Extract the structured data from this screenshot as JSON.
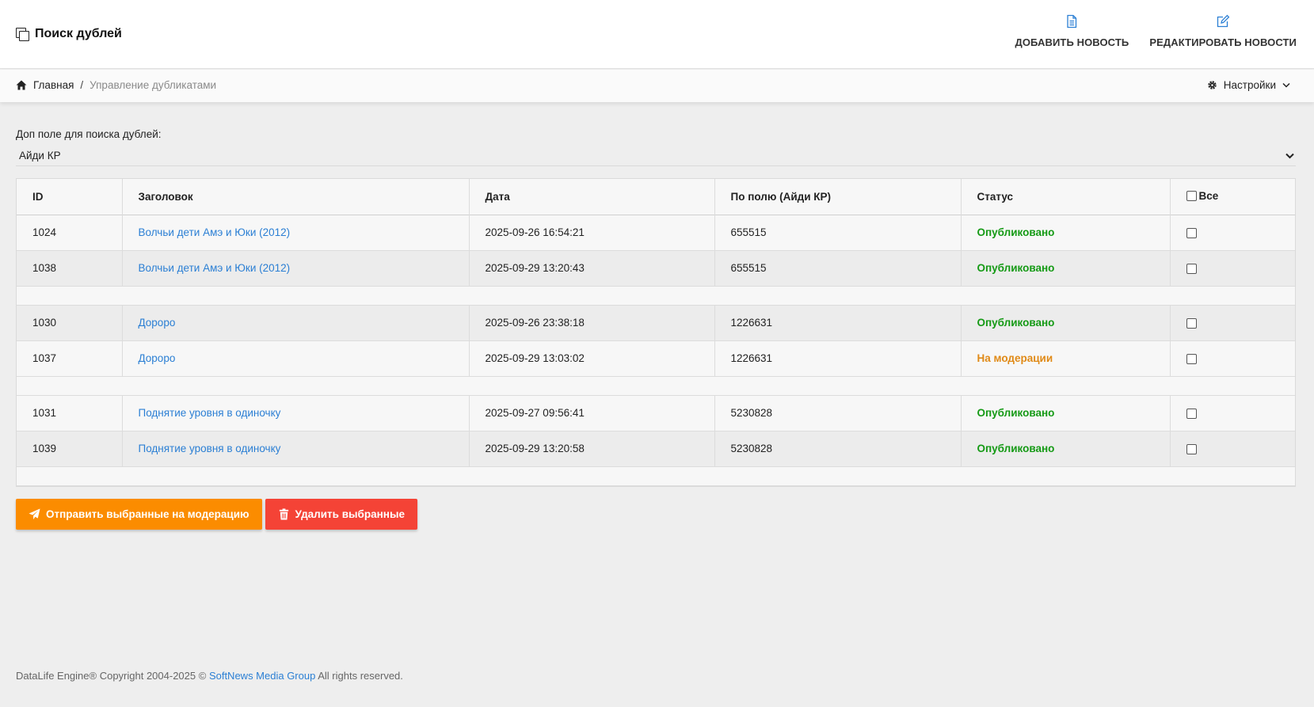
{
  "header": {
    "title": "Поиск дублей",
    "actions": [
      {
        "label": "ДОБАВИТЬ НОВОСТЬ",
        "icon": "file-icon"
      },
      {
        "label": "РЕДАКТИРОВАТЬ НОВОСТИ",
        "icon": "edit-icon"
      }
    ]
  },
  "breadcrumb": {
    "home": "Главная",
    "separator": "/",
    "current": "Управление дубликатами"
  },
  "settings": {
    "label": "Настройки"
  },
  "field": {
    "label": "Доп поле для поиска дублей:",
    "selected": "Айди КР"
  },
  "table": {
    "headers": {
      "id": "ID",
      "title": "Заголовок",
      "date": "Дата",
      "field": "По полю (Айди КР)",
      "status": "Статус",
      "all": "Все"
    },
    "rows": [
      {
        "id": "1024",
        "title": "Волчьи дети Амэ и Юки (2012)",
        "date": "2025-09-26 16:54:21",
        "field": "655515",
        "status": "Опубликовано"
      },
      {
        "id": "1038",
        "title": "Волчьи дети Амэ и Юки (2012)",
        "date": "2025-09-29 13:20:43",
        "field": "655515",
        "status": "Опубликовано"
      },
      {
        "id": "1030",
        "title": "Дороро",
        "date": "2025-09-26 23:38:18",
        "field": "1226631",
        "status": "Опубликовано"
      },
      {
        "id": "1037",
        "title": "Дороро",
        "date": "2025-09-29 13:03:02",
        "field": "1226631",
        "status": "На модерации"
      },
      {
        "id": "1031",
        "title": "Поднятие уровня в одиночку",
        "date": "2025-09-27 09:56:41",
        "field": "5230828",
        "status": "Опубликовано"
      },
      {
        "id": "1039",
        "title": "Поднятие уровня в одиночку",
        "date": "2025-09-29 13:20:58",
        "field": "5230828",
        "status": "Опубликовано"
      }
    ]
  },
  "buttons": {
    "send_moderation": "Отправить выбранные на модерацию",
    "delete_selected": "Удалить выбранные"
  },
  "footer": {
    "prefix": "DataLife Engine® Copyright 2004-2025 ©",
    "link": "SoftNews Media Group",
    "suffix": "All rights reserved."
  },
  "colors": {
    "link": "#2b7fd4",
    "published": "#159a15",
    "moderation": "#e08a17",
    "orange_button": "#fb8c00",
    "red_button": "#f44336"
  }
}
